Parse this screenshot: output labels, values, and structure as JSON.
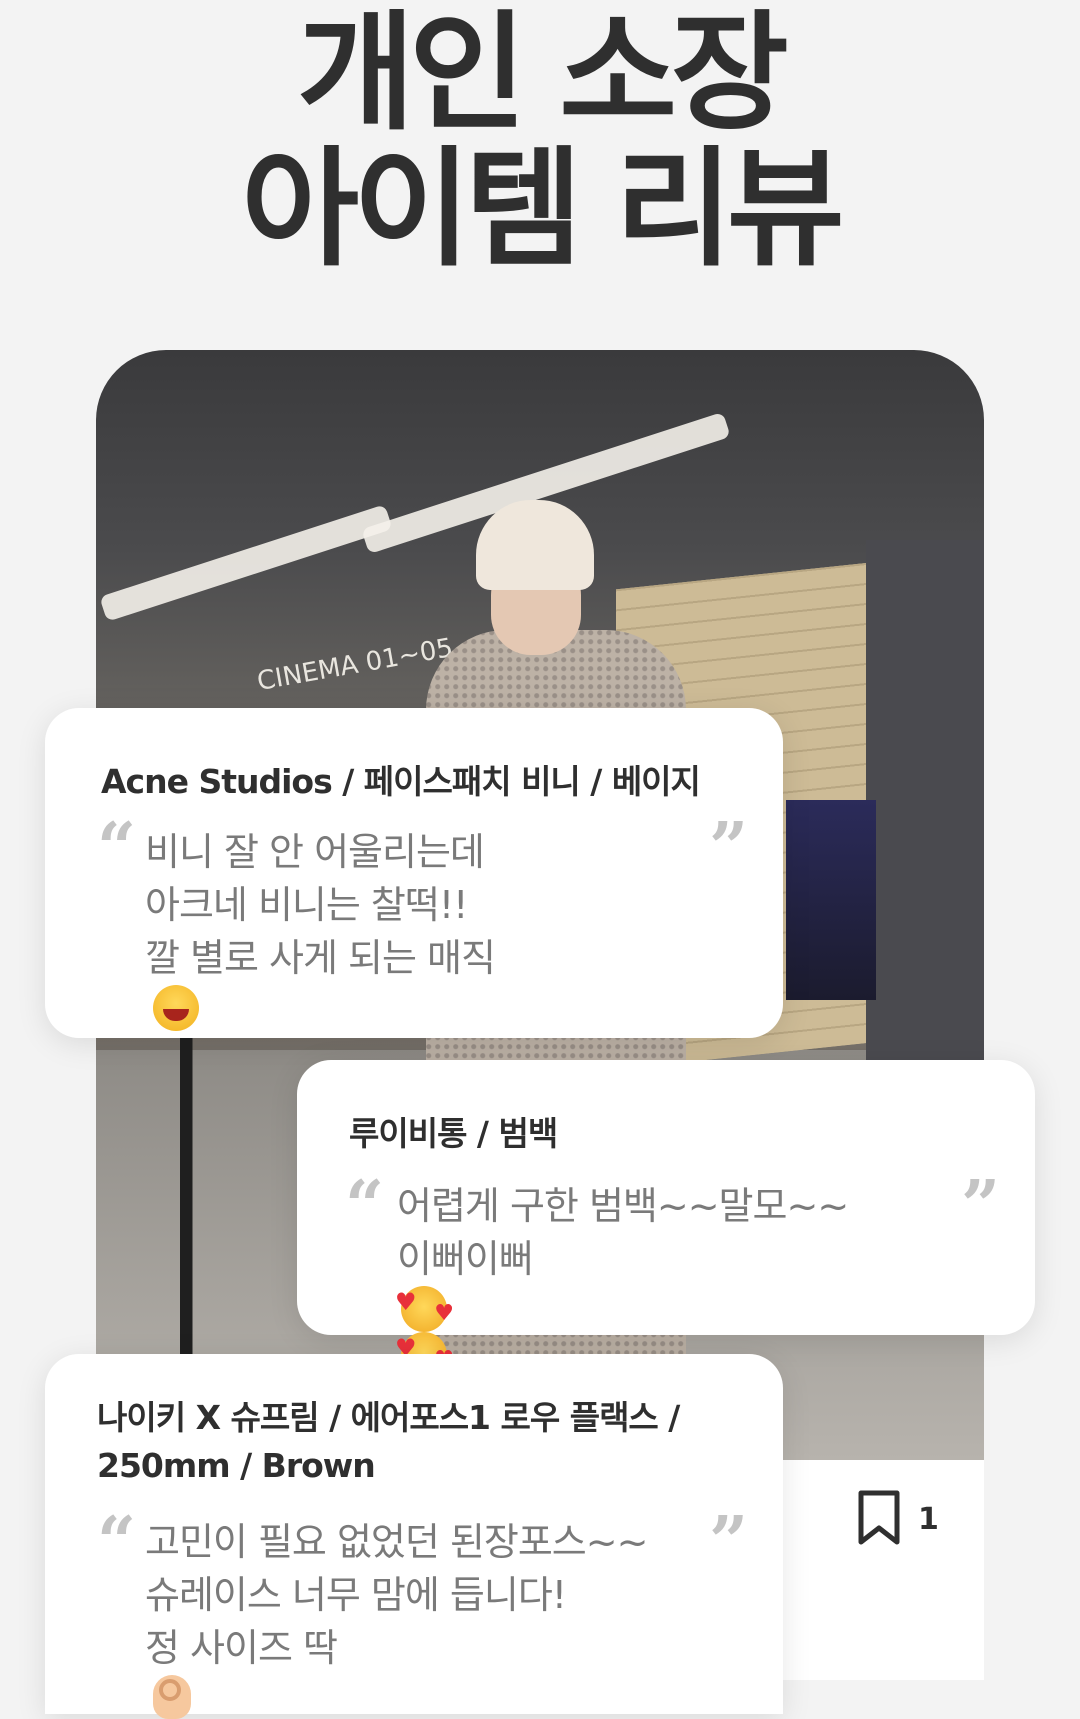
{
  "headline": {
    "line1": "개인 소장",
    "line2": "아이템 리뷰"
  },
  "photo": {
    "sign_text": "CINEMA 01~05"
  },
  "action_bar": {
    "share_icon": "share-icon",
    "bookmark_icon": "bookmark-icon",
    "bookmark_count": "1"
  },
  "reviews": [
    {
      "title": "Acne Studios / 페이스패치 비니 / 베이지",
      "lines": [
        "비니 잘 안 어울리는데",
        "아크네 비니는 찰떡!!",
        "깔 별로 사게 되는 매직"
      ],
      "emoji": "laughing-face-emoji"
    },
    {
      "title": "루이비통 / 범백",
      "lines": [
        "어렵게 구한 범백~~말모~~",
        "이뻐이뻐"
      ],
      "emoji": "smiling-face-with-hearts-emoji"
    },
    {
      "title_lines": [
        "나이키 X 슈프림 / 에어포스1 로우 플랙스 /",
        "250mm / Brown"
      ],
      "lines": [
        "고민이 필요 없었던 된장포스~~",
        "슈레이스 너무 맘에 듭니다!",
        "정 사이즈 딱"
      ],
      "emoji": "ok-hand-emoji"
    }
  ],
  "quote_marks": {
    "open": "“",
    "close": "”"
  }
}
